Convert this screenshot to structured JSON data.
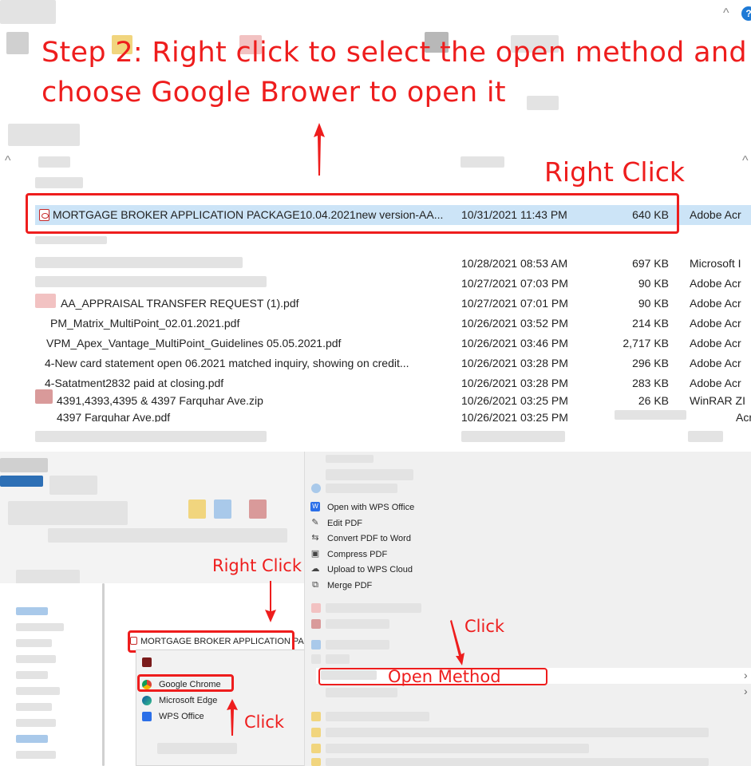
{
  "instruction": {
    "line1": "Step 2: Right click to select the open method and",
    "line2": "choose Google Brower to open it"
  },
  "annotations": {
    "right_click": "Right Click",
    "click": "Click",
    "open_method": "Open Method"
  },
  "colors": {
    "annotation_red": "#ee1d1d",
    "selected_row": "#cce4f7"
  },
  "file_list": {
    "selected": {
      "name": "MORTGAGE BROKER APPLICATION PACKAGE10.04.2021new version-AA...",
      "date": "10/31/2021 11:43 PM",
      "size": "640 KB",
      "type": "Adobe Acr"
    },
    "rows": [
      {
        "name": "",
        "date": "10/28/2021 08:53 AM",
        "size": "697 KB",
        "type": "Microsoft I"
      },
      {
        "name": "",
        "date": "10/27/2021 07:03 PM",
        "size": "90 KB",
        "type": "Adobe Acr"
      },
      {
        "name": "AA_APPRAISAL TRANSFER REQUEST (1).pdf",
        "date": "10/27/2021 07:01 PM",
        "size": "90 KB",
        "type": "Adobe Acr"
      },
      {
        "name": "PM_Matrix_MultiPoint_02.01.2021.pdf",
        "date": "10/26/2021 03:52 PM",
        "size": "214 KB",
        "type": "Adobe Acr"
      },
      {
        "name": "VPM_Apex_Vantage_MultiPoint_Guidelines 05.05.2021.pdf",
        "date": "10/26/2021 03:46 PM",
        "size": "2,717 KB",
        "type": "Adobe Acr"
      },
      {
        "name": "4-New card statement  open 06.2021 matched inquiry, showing on credit...",
        "date": "10/26/2021 03:28 PM",
        "size": "296 KB",
        "type": "Adobe Acr"
      },
      {
        "name": "4-Satatment2832 paid at closing.pdf",
        "date": "10/26/2021 03:28 PM",
        "size": "283 KB",
        "type": "Adobe Acr"
      },
      {
        "name": "4391,4393,4395 & 4397 Farquhar Ave.zip",
        "date": "10/26/2021 03:25 PM",
        "size": "26 KB",
        "type": "WinRAR ZI"
      },
      {
        "name": "4397 Farquhar Ave.pdf",
        "date": "10/26/2021 03:25 PM",
        "size": "",
        "type": "Acr"
      }
    ]
  },
  "lower_left": {
    "file_label": "MORTGAGE BROKER APPLICATION PAC",
    "open_with_apps": [
      {
        "label": "",
        "icon": "adobe-icon"
      },
      {
        "label": "Google Chrome",
        "icon": "chrome-icon"
      },
      {
        "label": "Microsoft Edge",
        "icon": "edge-icon"
      },
      {
        "label": "WPS Office",
        "icon": "wps-icon"
      }
    ]
  },
  "context_menu": {
    "items": [
      {
        "label": "Open with WPS Office",
        "icon": "wps-icon",
        "glyph": "W"
      },
      {
        "label": "Edit PDF",
        "icon": "pen-icon",
        "glyph": "✎"
      },
      {
        "label": "Convert PDF to Word",
        "icon": "convert-icon",
        "glyph": "⇆"
      },
      {
        "label": "Compress PDF",
        "icon": "compress-icon",
        "glyph": "▣"
      },
      {
        "label": "Upload to WPS Cloud",
        "icon": "cloud-icon",
        "glyph": "☁"
      },
      {
        "label": "Merge PDF",
        "icon": "merge-icon",
        "glyph": "⧉"
      }
    ],
    "open_method": "Open Method",
    "submenu_chevron": "›"
  }
}
